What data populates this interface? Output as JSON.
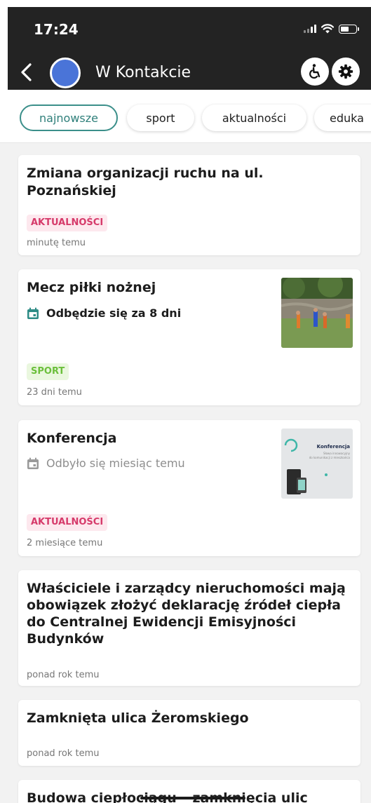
{
  "status_bar": {
    "time": "17:24"
  },
  "navbar": {
    "title": "W Kontakcie",
    "avatar_color": "#4a74d8",
    "back_icon": "chevron-left-icon",
    "accessibility_icon": "wheelchair-icon",
    "settings_icon": "gear-icon"
  },
  "tabs": [
    {
      "label": "najnowsze",
      "active": true
    },
    {
      "label": "sport",
      "active": false
    },
    {
      "label": "aktualności",
      "active": false
    },
    {
      "label": "eduka",
      "active": false
    }
  ],
  "colors": {
    "accent": "#3b8f8a",
    "news_badge": "#d63a6a",
    "sport_badge": "#6bbf3b",
    "header_bg": "#232323"
  },
  "feed": [
    {
      "title_lines": [
        "Zmiana organizacji ruchu na ul.",
        "Poznańskiej"
      ],
      "badge": "AKTUALNOŚCI",
      "ago": "minutę temu"
    },
    {
      "title_lines": [
        "Mecz piłki nożnej"
      ],
      "event": "Odbędzie się za 8 dni",
      "badge": "SPORT",
      "ago": "23 dni temu"
    },
    {
      "title_lines": [
        "Konferencja"
      ],
      "event": "Odbyło się miesiąc temu",
      "badge": "AKTUALNOŚCI",
      "ago": "2 miesiące temu",
      "thumb": {
        "heading": "Konferencja",
        "line1": "Słowa innowacyjny",
        "line2": "do komunikacji z mieszkańca"
      }
    },
    {
      "title_lines": [
        "Właściciele i zarządcy nieruchomości mają",
        "obowiązek złożyć deklarację źródeł ciepła",
        "do Centralnej Ewidencji Emisyjności",
        "Budynków"
      ],
      "ago": "ponad rok temu"
    },
    {
      "title_lines": [
        "Zamknięta ulica Żeromskiego"
      ],
      "ago": "ponad rok temu"
    },
    {
      "title_lines": [
        "Budowa ciepłociągu – zamknięcia ulic"
      ]
    }
  ]
}
